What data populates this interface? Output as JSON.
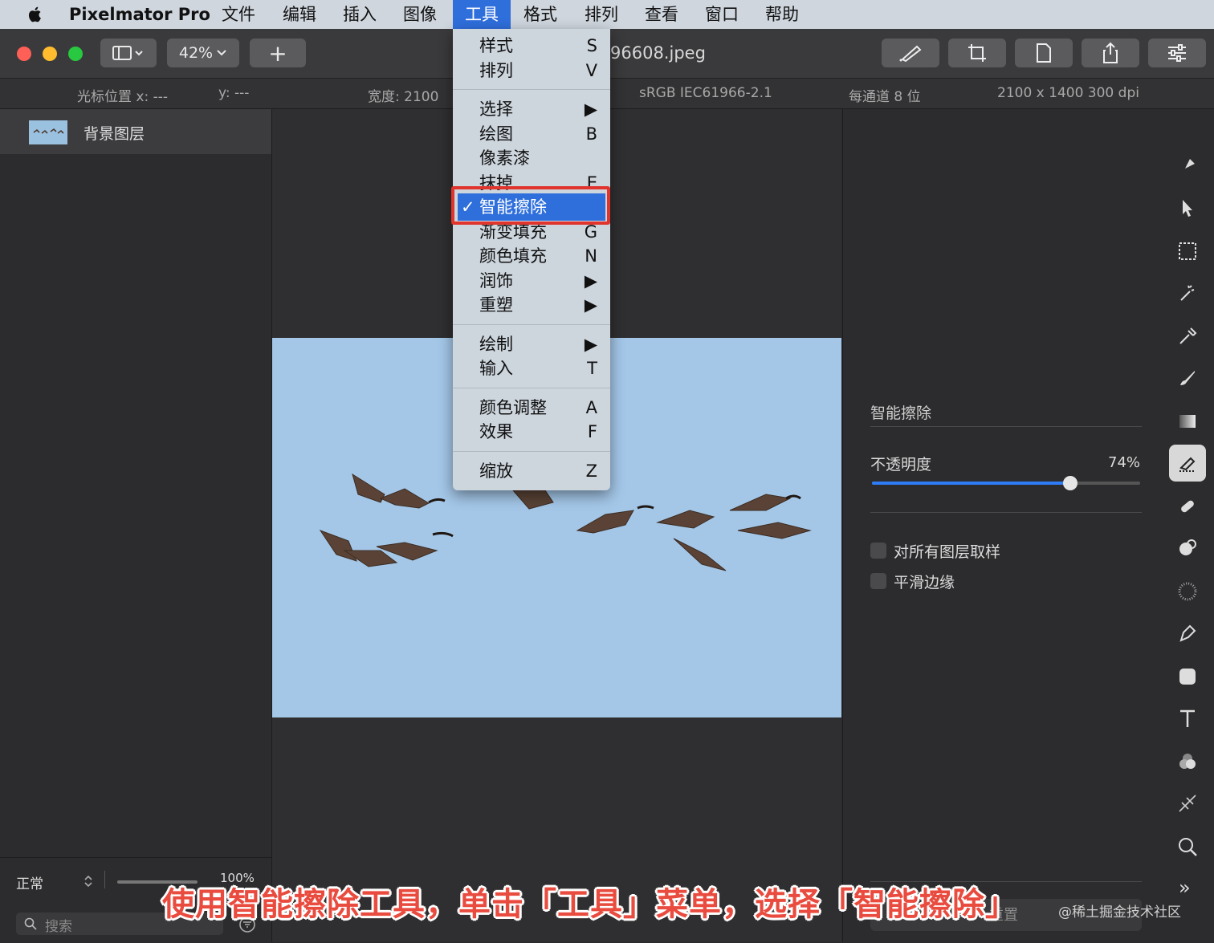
{
  "menubar": {
    "app_name": "Pixelmator Pro",
    "items": [
      "文件",
      "编辑",
      "插入",
      "图像",
      "工具",
      "格式",
      "排列",
      "查看",
      "窗口",
      "帮助"
    ],
    "active_index": 4
  },
  "toolbar": {
    "zoom": "42%",
    "add_label": "+",
    "document_title": "96608.jpeg"
  },
  "infobar": {
    "cursor_x": "光标位置 x:  ---",
    "cursor_y": "y:  ---",
    "width": "宽度:  2100",
    "color_profile": "sRGB IEC61966-2.1",
    "bit_depth": "每通道 8 位",
    "dimensions": "2100 x 1400 300 dpi"
  },
  "layers": {
    "items": [
      {
        "name": "背景图层"
      }
    ],
    "blend_mode": "正常",
    "opacity": "100%",
    "search_placeholder": "搜索"
  },
  "tools_menu": {
    "groups": [
      [
        {
          "label": "样式",
          "shortcut": "S"
        },
        {
          "label": "排列",
          "shortcut": "V"
        }
      ],
      [
        {
          "label": "选择",
          "shortcut": "▶"
        },
        {
          "label": "绘图",
          "shortcut": "B"
        },
        {
          "label": "像素漆",
          "shortcut": ""
        },
        {
          "label": "抹掉",
          "shortcut": "E"
        },
        {
          "label": "智能擦除",
          "shortcut": "",
          "checked": true
        },
        {
          "label": "渐变填充",
          "shortcut": "G"
        },
        {
          "label": "颜色填充",
          "shortcut": "N"
        },
        {
          "label": "润饰",
          "shortcut": "▶"
        },
        {
          "label": "重塑",
          "shortcut": "▶"
        }
      ],
      [
        {
          "label": "绘制",
          "shortcut": "▶"
        },
        {
          "label": "输入",
          "shortcut": "T"
        }
      ],
      [
        {
          "label": "颜色调整",
          "shortcut": "A"
        },
        {
          "label": "效果",
          "shortcut": "F"
        }
      ],
      [
        {
          "label": "缩放",
          "shortcut": "Z"
        }
      ]
    ],
    "highlighted_label": "智能擦除",
    "check_mark": "✓"
  },
  "settings": {
    "tool_name": "智能擦除",
    "opacity_label": "不透明度",
    "opacity_value": "74%",
    "opacity_fraction": 0.74,
    "sample_all_layers": "对所有图层取样",
    "smooth_edges": "平滑边缘",
    "reset_label": "重置"
  },
  "tools_sidebar": {
    "icons": [
      "style-icon",
      "arrange-icon",
      "rect-select-icon",
      "magic-select-icon",
      "color-picker-icon",
      "paint-icon",
      "gradient-icon",
      "smart-erase-icon",
      "repair-icon",
      "clone-icon",
      "blur-icon",
      "pen-icon",
      "shape-icon",
      "type-icon",
      "color-adjust-icon",
      "effects-icon",
      "zoom-icon"
    ],
    "selected": "smart-erase-icon",
    "more_label": "»"
  },
  "caption": "使用智能擦除工具，单击「工具」菜单，选择「智能擦除」",
  "watermark": "@稀土掘金技术社区",
  "colors": {
    "accent": "#2f6fdc",
    "highlight_outline": "#e0342c",
    "caption_red": "#e94b3f",
    "sky": "#a4c7e8"
  }
}
